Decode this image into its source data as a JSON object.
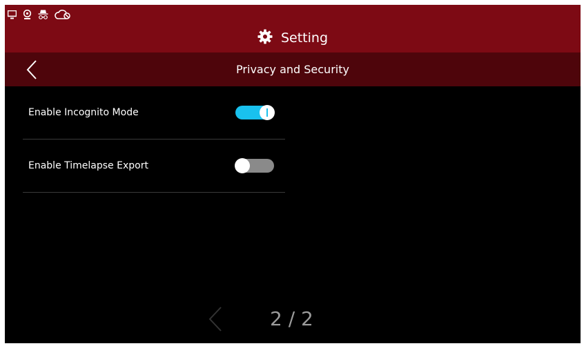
{
  "header": {
    "title": "Setting",
    "subtitle": "Privacy and Security",
    "status_icons": [
      "monitor-icon",
      "webcam-icon",
      "incognito-icon",
      "cloud-off-icon"
    ]
  },
  "settings": [
    {
      "label": "Enable Incognito Mode",
      "enabled": true
    },
    {
      "label": "Enable Timelapse Export",
      "enabled": false
    }
  ],
  "pager": {
    "text": "2 / 2"
  },
  "colors": {
    "header_bg": "#7d0a14",
    "subheader_bg": "#4e050b",
    "toggle_on": "#19c1ee",
    "toggle_off": "#8a8a8a"
  }
}
